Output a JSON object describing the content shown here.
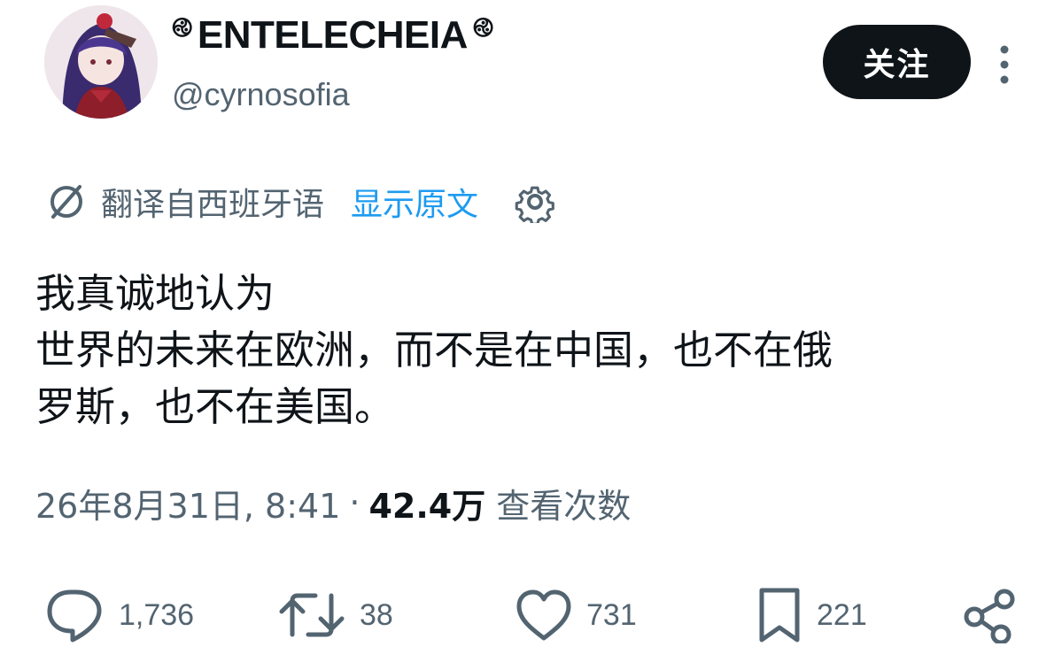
{
  "user": {
    "display_name": "ENTELECHEIA",
    "name_decoration": "࿋",
    "handle": "@cyrnosofia",
    "avatar_icon": "avatar-image"
  },
  "header": {
    "follow_label": "关注",
    "more_icon": "more-vertical-icon"
  },
  "translation": {
    "label": "翻译自西班牙语",
    "show_original": "显示原文",
    "icon": "translate-icon",
    "settings_icon": "gear-icon"
  },
  "tweet": {
    "lines": [
      "我真诚地认为",
      "世界的未来在欧洲，而不是在中国，也不在俄",
      "罗斯，也不在美国。"
    ]
  },
  "meta": {
    "timestamp": "26年8月31日, 8:41",
    "separator": "·",
    "views_count": "42.4万",
    "views_label": "查看次数"
  },
  "actions": {
    "reply_count": "1,736",
    "retweet_count": "38",
    "like_count": "731",
    "bookmark_count": "221"
  },
  "colors": {
    "text_primary": "#0f1419",
    "text_secondary": "#536471",
    "link": "#1d9bf0",
    "button_bg": "#0f1419"
  }
}
